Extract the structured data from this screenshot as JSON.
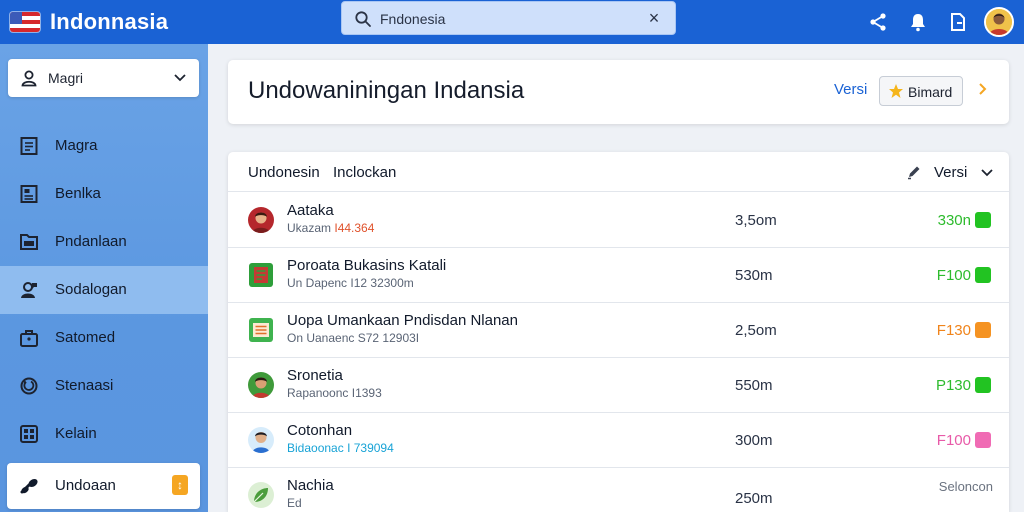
{
  "app": {
    "title": "Indonnasia",
    "accent": "#1a62d4"
  },
  "search": {
    "value": "Fndonesia",
    "placeholder": "Fndonesia"
  },
  "top_icons": [
    "share-icon",
    "bell-icon",
    "document-icon",
    "avatar"
  ],
  "sidebar": {
    "user_select": {
      "label": "Magri"
    },
    "items": [
      {
        "label": "Magra",
        "icon": "document-list-icon",
        "active": false
      },
      {
        "label": "Benlka",
        "icon": "note-icon",
        "active": false
      },
      {
        "label": "Pndanlaan",
        "icon": "folder-icon",
        "active": false
      },
      {
        "label": "Sodalogan",
        "icon": "user-chat-icon",
        "active": true
      },
      {
        "label": "Satomed",
        "icon": "briefcase-icon",
        "active": false
      },
      {
        "label": "Stenaasi",
        "icon": "refresh-icon",
        "active": false
      },
      {
        "label": "Kelain",
        "icon": "grid-icon",
        "active": false
      }
    ],
    "bottom": {
      "label": "Undoaan",
      "icon": "link-icon",
      "badge": "↕"
    }
  },
  "header": {
    "title": "Undowaniningan Indansia",
    "versi_link": "Versi",
    "button_label": "Bimard"
  },
  "list": {
    "col1": "Undonesin",
    "col2": "Inclockan",
    "versi": "Versi",
    "rows": [
      {
        "title": "Aataka",
        "sub_prefix": "Ukazam",
        "sub_value": "I44.364",
        "sub_color": "#e0522c",
        "time": "3,5om",
        "code": "330n",
        "code_color": "#2dbb2d",
        "dot_color": "#22c322",
        "avatar": "person-red"
      },
      {
        "title": "Poroata Bukasins Katali",
        "sub_prefix": "Un Dapenc",
        "sub_value": "I12 32300m",
        "sub_color": "#5a6475",
        "time": "530m",
        "code": "F100",
        "code_color": "#2dbb2d",
        "dot_color": "#22c322",
        "avatar": "green-doc"
      },
      {
        "title": "Uopa Umankaan Pndisdan Nlanan",
        "sub_prefix": "On Uanaenc",
        "sub_value": "S72 12903I",
        "sub_color": "#5a6475",
        "time": "2,5om",
        "code": "F130",
        "code_color": "#f0841b",
        "dot_color": "#f59322",
        "avatar": "green-list"
      },
      {
        "title": "Sronetia",
        "sub_prefix": "Rapanoonc",
        "sub_value": "I1393",
        "sub_color": "#5a6475",
        "time": "550m",
        "code": "P130",
        "code_color": "#2dbb2d",
        "dot_color": "#22c322",
        "avatar": "person-green"
      },
      {
        "title": "Cotonhan",
        "sub_prefix": "Bidaoonac",
        "sub_value": "I 739094",
        "sub_color": "#18a3d6",
        "time": "300m",
        "code": "F100",
        "code_color": "#e85aa8",
        "dot_color": "#f06bb4",
        "avatar": "person-blue"
      },
      {
        "title": "Nachia",
        "sub_prefix": "Ed",
        "sub_value": "",
        "sub_color": "#5a6475",
        "time": "250m",
        "code": "Seloncon",
        "code_color": "#6b7380",
        "dot_color": "",
        "avatar": "person-leaf"
      }
    ]
  }
}
